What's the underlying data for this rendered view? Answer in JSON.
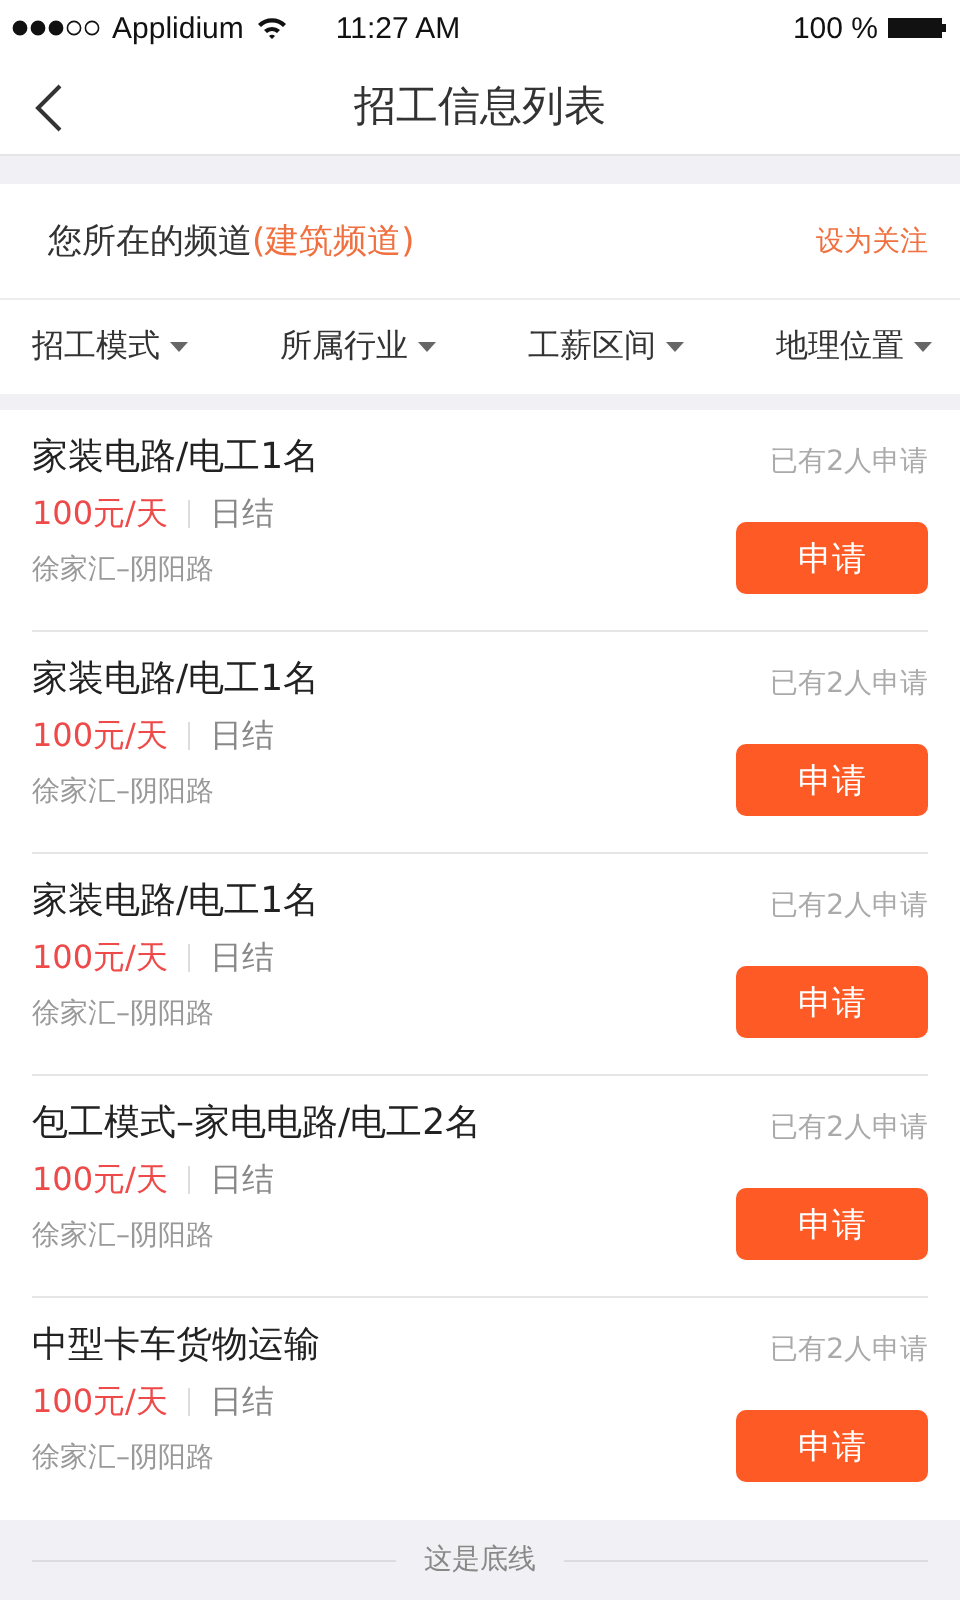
{
  "status_bar": {
    "carrier": "Applidium",
    "time": "11:27 AM",
    "battery": "100 %"
  },
  "nav": {
    "title": "招工信息列表"
  },
  "channel": {
    "label": "您所在的频道",
    "name": "(建筑频道)",
    "action": "设为关注"
  },
  "filters": [
    {
      "label": "招工模式"
    },
    {
      "label": "所属行业"
    },
    {
      "label": "工薪区间"
    },
    {
      "label": "地理位置"
    }
  ],
  "jobs": [
    {
      "title": "家装电路/电工1名",
      "pay": "100元/天",
      "settlement": "日结",
      "location": "徐家汇–阴阳路",
      "applicants": "已有2人申请",
      "button": "申请"
    },
    {
      "title": "家装电路/电工1名",
      "pay": "100元/天",
      "settlement": "日结",
      "location": "徐家汇–阴阳路",
      "applicants": "已有2人申请",
      "button": "申请"
    },
    {
      "title": "家装电路/电工1名",
      "pay": "100元/天",
      "settlement": "日结",
      "location": "徐家汇–阴阳路",
      "applicants": "已有2人申请",
      "button": "申请"
    },
    {
      "title": "包工模式–家电电路/电工2名",
      "pay": "100元/天",
      "settlement": "日结",
      "location": "徐家汇–阴阳路",
      "applicants": "已有2人申请",
      "button": "申请"
    },
    {
      "title": "中型卡车货物运输",
      "pay": "100元/天",
      "settlement": "日结",
      "location": "徐家汇–阴阳路",
      "applicants": "已有2人申请",
      "button": "申请"
    }
  ],
  "footer": {
    "text": "这是底线"
  }
}
